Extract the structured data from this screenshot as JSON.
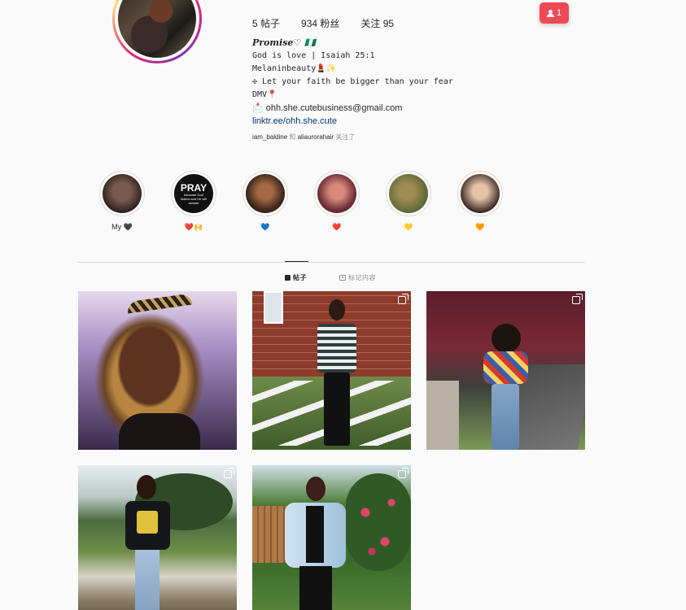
{
  "profile": {
    "stats": {
      "posts": "5 帖子",
      "followers": "934 粉丝",
      "following": "关注 95"
    },
    "notification_badge": "1",
    "bio": {
      "name": "𝑷𝒓𝒐𝒎𝒊𝒔𝒆♡ 🇳🇬",
      "lines": [
        "God is love | Isaiah 25:1",
        "Melaninbeauty💄✨",
        "✣ Let your faith be bigger than your fear",
        "DMV📍",
        "📩 ohh.she.cutebusiness@gmail.com"
      ],
      "link": "linktr.ee/ohh.she.cute",
      "followed_by": {
        "user1": "iam_baldine",
        "joiner": "和",
        "user2": "aliaurorahair",
        "suffix": "关注了"
      }
    }
  },
  "highlights": [
    {
      "label": "My 🖤",
      "color_a": "#7a5a50",
      "color_b": "#2e221e"
    },
    {
      "label": "❤️🙌",
      "color_a": "#111111",
      "color_b": "#111111",
      "text": "PRAY",
      "subtext": "because God listens and He will answer"
    },
    {
      "label": "💙",
      "color_a": "#a56a45",
      "color_b": "#3a2418"
    },
    {
      "label": "❤️",
      "color_a": "#d98a7a",
      "color_b": "#6a2b36"
    },
    {
      "label": "💛",
      "color_a": "#a08a55",
      "color_b": "#5a6a35"
    },
    {
      "label": "🧡",
      "color_a": "#e6c3a8",
      "color_b": "#3a2a22"
    }
  ],
  "tabs": {
    "posts": "帖子",
    "tagged": "标记内容"
  },
  "colors": {
    "accent_red": "#ed4956",
    "link_blue": "#00376b",
    "muted_gray": "#8e8e8e"
  }
}
